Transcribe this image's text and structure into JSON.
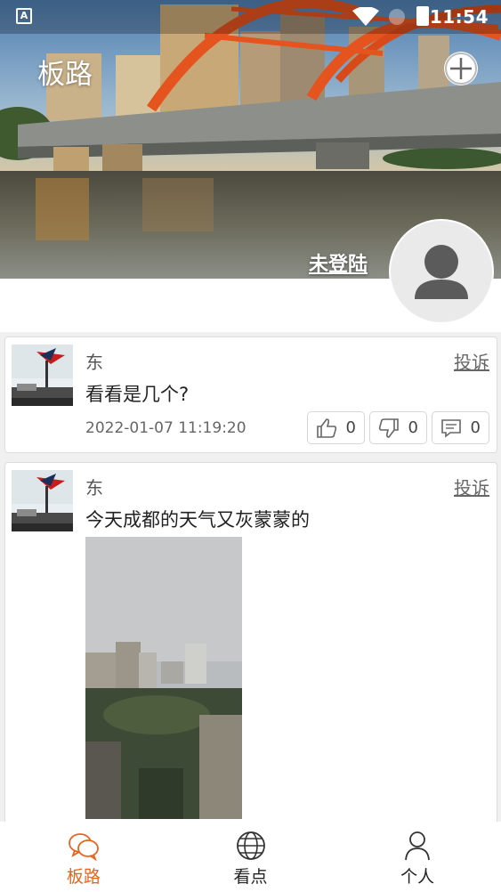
{
  "status_bar": {
    "time": "11:54",
    "notification_icon": "A"
  },
  "header": {
    "title": "板路",
    "login_text": "未登陆"
  },
  "posts": [
    {
      "user": "东",
      "report_label": "投诉",
      "content": "看看是几个?",
      "time": "2022-01-07 11:19:20",
      "likes": "0",
      "dislikes": "0",
      "comments": "0"
    },
    {
      "user": "东",
      "report_label": "投诉",
      "content": "今天成都的天气又灰蒙蒙的"
    }
  ],
  "bottom_nav": [
    {
      "label": "板路",
      "icon": "chat-bubbles-icon",
      "active": true
    },
    {
      "label": "看点",
      "icon": "globe-icon",
      "active": false
    },
    {
      "label": "个人",
      "icon": "person-icon",
      "active": false
    }
  ],
  "colors": {
    "accent": "#e8641e"
  }
}
